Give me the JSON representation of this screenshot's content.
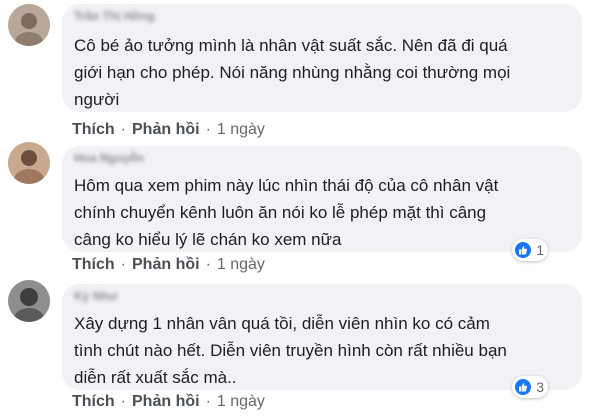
{
  "comments": [
    {
      "author": "Trần Thị Hồng",
      "lines": [
        "Cô bé ảo tưởng mình là nhân vật suất sắc. Nên đã đi quá",
        "giới hạn cho phép. Nói năng nhùng nhằng coi thường mọi",
        "người"
      ],
      "actions": {
        "like": "Thích",
        "reply": "Phản hồi",
        "time": "1 ngày"
      },
      "reactions": null
    },
    {
      "author": "Hoa Nguyễn",
      "lines": [
        "Hôm qua xem phim này lúc nhìn thái độ của cô nhân vật",
        "chính chuyển kênh luôn ăn nói ko lễ phép mặt thì câng",
        "câng ko hiểu lý lẽ chán ko xem nữa"
      ],
      "actions": {
        "like": "Thích",
        "reply": "Phản hồi",
        "time": "1 ngày"
      },
      "reactions": {
        "icon": "like-icon",
        "count": "1"
      }
    },
    {
      "author": "Kỳ Như",
      "lines": [
        "Xây dựng 1 nhân vân quá tồi, diễn viên nhìn ko có cảm",
        "tình chút nào hết. Diễn viên truyền hình còn rất nhiều bạn",
        "diễn rất xuất sắc mà.."
      ],
      "actions": {
        "like": "Thích",
        "reply": "Phản hồi",
        "time": "1 ngày"
      },
      "reactions": {
        "icon": "like-icon",
        "count": "3"
      }
    }
  ],
  "colors": {
    "bubble": "#f0f2f5",
    "text": "#1c1e21",
    "meta": "#65676b",
    "like": "#1877f2"
  },
  "separator": "·"
}
